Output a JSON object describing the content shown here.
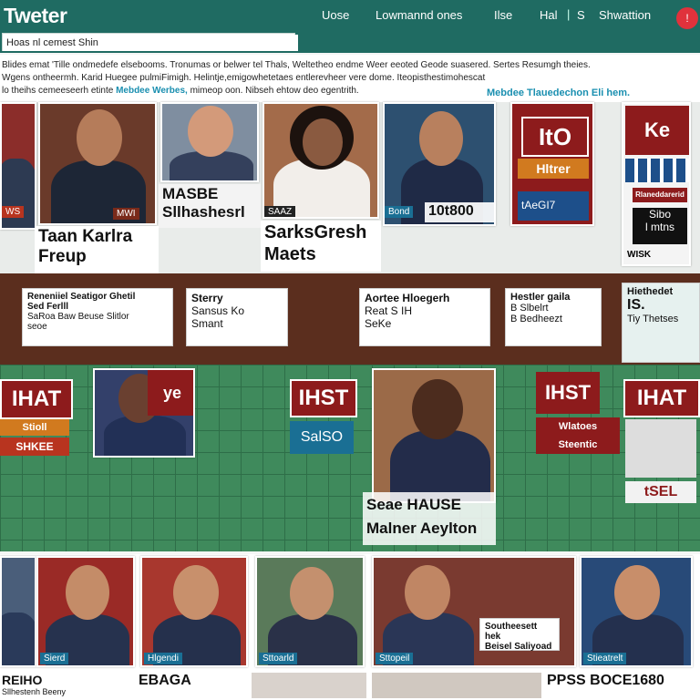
{
  "header": {
    "logo": "Tweter",
    "nav": [
      "Uose",
      "Lowmannd ones",
      "Ilse",
      "Hal",
      "S",
      "Shwattion"
    ],
    "search_value": "Hoas nl cemest Shin",
    "alert": "!"
  },
  "headlines": {
    "line1": "Blides emat 'Tille ondmedefe elsebooms. Tronumas or belwer tel Thals, Weltetheo endme Weer eeoted Geode suasered. Sertes Resumgh theies.",
    "line2": "Wgens ontheermh. Karid Huegee pulmiFimigh. Helintje,emigowhetetaes entlerevheer vere dome. Iteopisthestimohescat",
    "line3": "lo theihs cemeeseerh etinte",
    "line3_link": "Mebdee Werbes,",
    "line3_tail": "mimeop oon. Nibseh ehtow deo egentrith.",
    "right_link": "Mebdee Tlauedechon Eli hem."
  },
  "tiles_top": {
    "t1_tag": "WS",
    "t2_tag": "MWI",
    "t2_caption": "Taan Karlra Freup",
    "t3_caption": "MASBE Sllhashesrl",
    "t4_caption": "SarksGresh Maets",
    "t4_tag": "SAAZ",
    "t5_tag": "Bond",
    "t5_caption": "10t800",
    "t6_logo": "ItO",
    "t6_sub": "Hltrer",
    "t6_tag": "tAeGI7",
    "t7_logo": "Ke",
    "t7_sub1": "Rlaneddarerid",
    "t7_sub2": "Sibo",
    "t7_sub3": "l mtns",
    "t7_tag": "WISK"
  },
  "cards": {
    "c1_title": "Reneniiel Seatigor Ghetil",
    "c1_sub": "Sed Ferlll",
    "c1_sub2": "SaRoa Baw Beuse Slitlor",
    "c1_sub3": "seoe",
    "c2_title": "Sterry",
    "c2_sub": "Sansus Ko",
    "c2_sub2": "Smant",
    "c3_title": "Aortee Hloegerh",
    "c3_sub": "Reat S IH",
    "c3_sub2": "SeKe",
    "c4_title": "Hestler gaila",
    "c4_sub": "B Slbelrt",
    "c4_sub2": "B Bedheezt",
    "c5_title": "Hiethedet",
    "c5_sub": "IS.",
    "c5_sub2": "Tiy Thetses"
  },
  "wall": {
    "w1_logo": "IHAT",
    "w1_sub": "Stioll",
    "w1_tag": "SHKEE",
    "w2_tag": "ye",
    "w3_logo": "IHST",
    "w3_sub": "SalSO",
    "w4_caption1": "Seae HAUSE",
    "w4_caption2": "Malner Aeylton",
    "w5_logo": "IHAT",
    "w5_sub": "Wlatoes",
    "w5_sub2": "Steentic",
    "w5_tag": "tSEL"
  },
  "bottom": {
    "b1_tag": "Sierd",
    "b2_tag": "Hlgendi",
    "b3_tag": "Sttoarld",
    "b4_tag": "Sttopeil",
    "b4_card1": "Southeesett hek",
    "b4_card2": "Beisel Saliyoad",
    "b5_tag": "Stieatrelt"
  },
  "footer": {
    "f1": "REIHO",
    "f1_small": "Sllhestenh  Beeny",
    "f2": "EBAGA",
    "f3": "",
    "f4": "PPSS BOCE1680"
  },
  "colors": {
    "header": "#1f6b62",
    "accent_link": "#1a8fb0",
    "brand_red": "#8d1b1c",
    "wall_green": "#3f8a5c",
    "alert": "#e0323c"
  }
}
